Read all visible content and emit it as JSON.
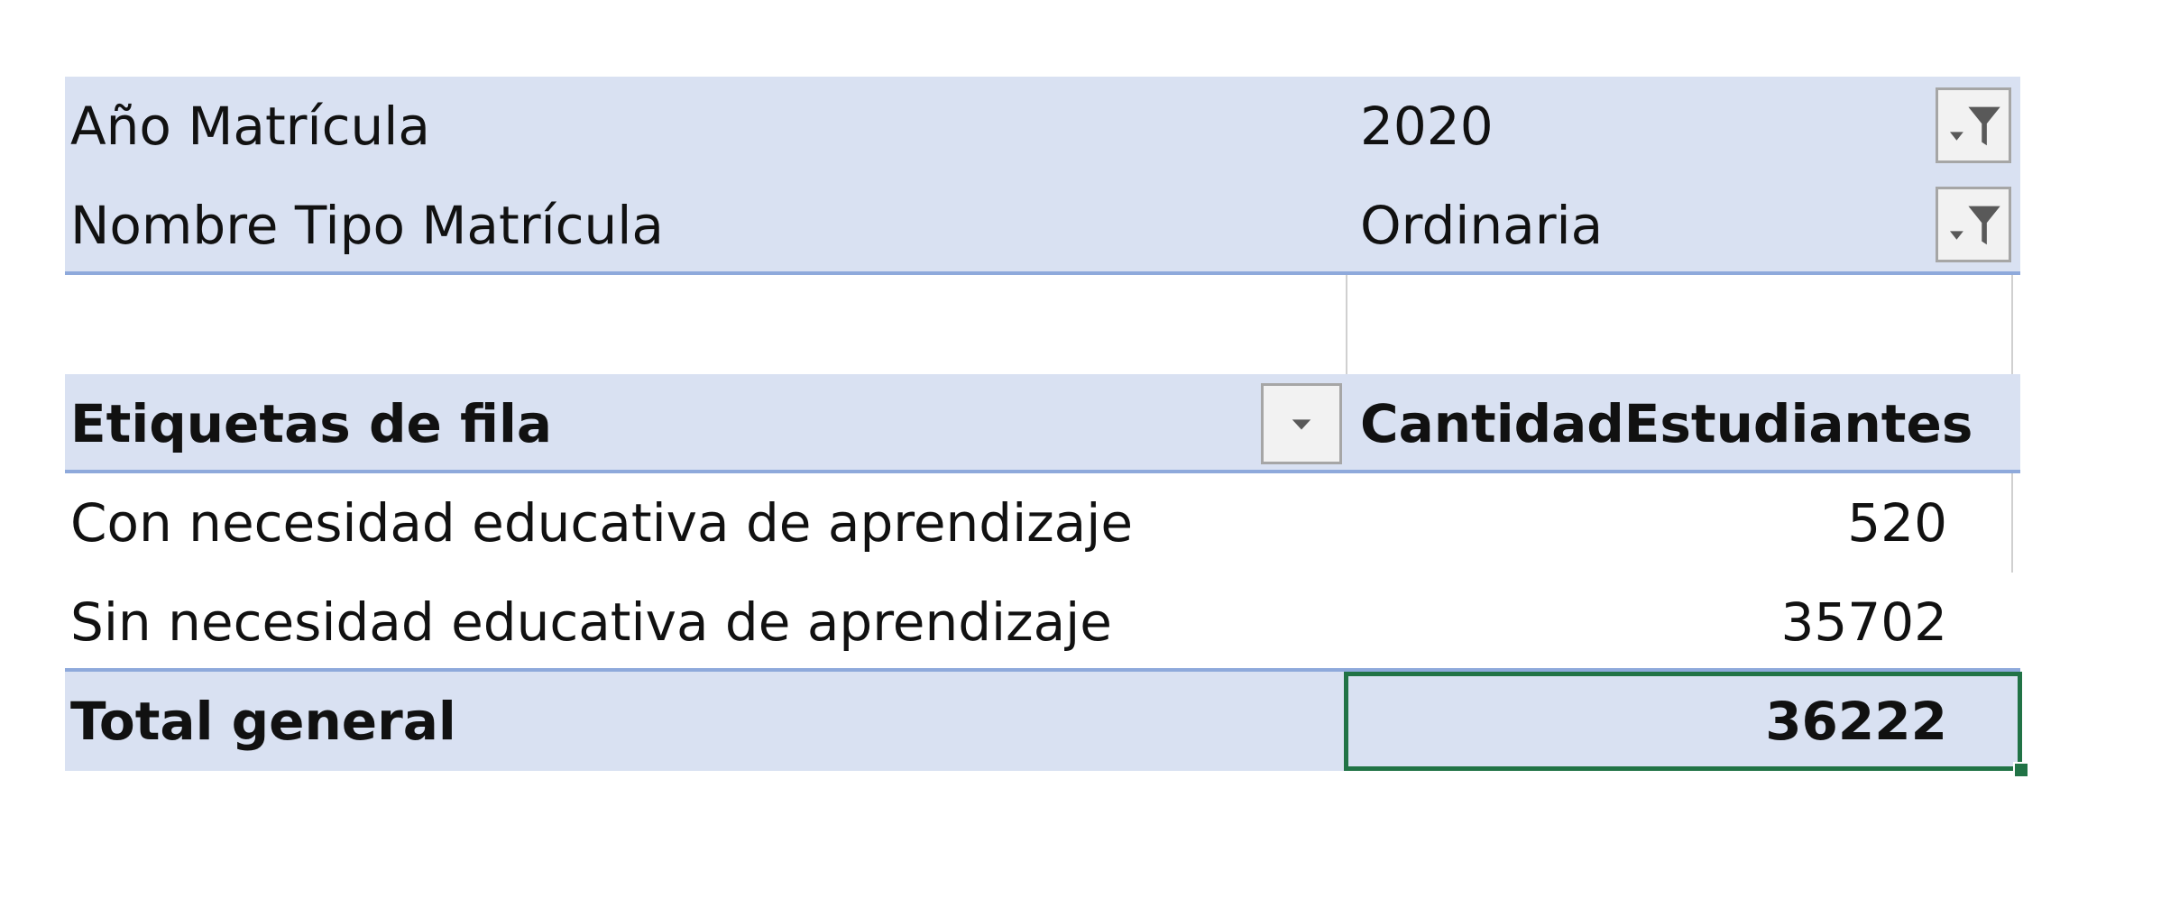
{
  "filters": [
    {
      "label": "Año Matrícula",
      "value": "2020",
      "icon": "filter-dropdown-icon"
    },
    {
      "label": "Nombre Tipo Matrícula",
      "value": "Ordinaria",
      "icon": "filter-dropdown-icon"
    }
  ],
  "header": {
    "row_labels": "Etiquetas de fila",
    "value_field": "CantidadEstudiantes",
    "dropdown_icon": "chevron-down-icon"
  },
  "rows": [
    {
      "label": "Con necesidad educativa de aprendizaje",
      "value": "520"
    },
    {
      "label": "Sin necesidad educativa de aprendizaje",
      "value": "35702"
    }
  ],
  "total": {
    "label": "Total general",
    "value": "36222"
  },
  "colors": {
    "band": "#d9e1f2",
    "border": "#8ea9db",
    "selection": "#217346"
  }
}
